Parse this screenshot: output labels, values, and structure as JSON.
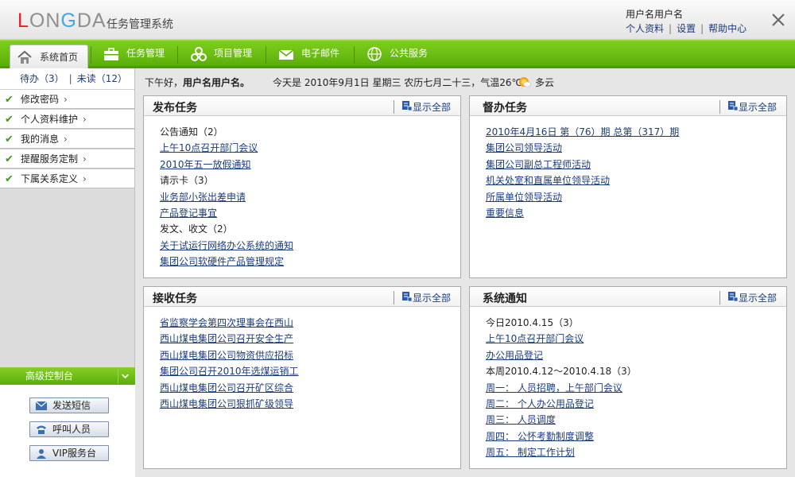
{
  "header": {
    "logo": {
      "l": "L",
      "on": "ON",
      "g": "G",
      "d": "D",
      "a": "A"
    },
    "app_title": "任务管理系统",
    "user_name": "用户名用户名",
    "links": [
      "个人资料",
      "设置",
      "帮助中心"
    ],
    "separator": "|"
  },
  "nav": {
    "items": [
      {
        "label": "系统首页",
        "icon": "home-icon"
      },
      {
        "label": "任务管理",
        "icon": "briefcase-icon"
      },
      {
        "label": "项目管理",
        "icon": "project-icon"
      },
      {
        "label": "电子邮件",
        "icon": "mail-icon"
      },
      {
        "label": "公共服务",
        "icon": "globe-icon"
      }
    ]
  },
  "sidebar": {
    "todo": "待办（3）",
    "unread": "未读（12）",
    "separator": "|",
    "items": [
      {
        "label": "修改密码"
      },
      {
        "label": "个人资料维护"
      },
      {
        "label": "我的消息"
      },
      {
        "label": "提醒服务定制"
      },
      {
        "label": "下属关系定义"
      }
    ],
    "advanced_title": "高级控制台",
    "buttons": [
      "发送短信",
      "呼叫人员",
      "VIP服务台"
    ]
  },
  "greeting": {
    "prefix": "下午好，",
    "user": "用户名用户名。",
    "today": "今天是 2010年9月1日 星期三 农历七月二十三，气温26℃",
    "weather": "多云"
  },
  "panels": {
    "show_all": "显示全部",
    "publish": {
      "title": "发布任务",
      "items": [
        {
          "text": "公告通知（2）",
          "type": "label"
        },
        {
          "text": "上午10点召开部门会议",
          "type": "link"
        },
        {
          "text": "2010年五一放假通知",
          "type": "link"
        },
        {
          "text": "请示卡（3）",
          "type": "label"
        },
        {
          "text": "业务部小张出差申请",
          "type": "link"
        },
        {
          "text": "产品登记事宜",
          "type": "link"
        },
        {
          "text": "发文、收文（2）",
          "type": "label"
        },
        {
          "text": "关于试运行网络办公系统的通知",
          "type": "link"
        },
        {
          "text": "集团公司软硬件产品管理规定",
          "type": "link"
        }
      ]
    },
    "supervise": {
      "title": "督办任务",
      "items": [
        {
          "text": "2010年4月16日 第（76）期 总第（317）期",
          "type": "link"
        },
        {
          "text": "集团公司领导活动",
          "type": "link"
        },
        {
          "text": "集团公司副总工程师活动",
          "type": "link"
        },
        {
          "text": "机关处室和直属单位领导活动",
          "type": "link"
        },
        {
          "text": "所属单位领导活动",
          "type": "link"
        },
        {
          "text": "重要信息",
          "type": "link"
        }
      ]
    },
    "receive": {
      "title": "接收任务",
      "items": [
        {
          "text": "省监察学会第四次理事会在西山",
          "type": "link"
        },
        {
          "text": "西山煤电集团公司召开安全生产",
          "type": "link"
        },
        {
          "text": "西山煤电集团公司物资供应招标",
          "type": "link"
        },
        {
          "text": "集团公司召开2010年选煤运销工",
          "type": "link"
        },
        {
          "text": "西山煤电集团公司召开矿区综合",
          "type": "link"
        },
        {
          "text": "西山煤电集团公司狠抓矿级领导",
          "type": "link"
        }
      ]
    },
    "notice": {
      "title": "系统通知",
      "items": [
        {
          "text": "今日2010.4.15（3）",
          "type": "label"
        },
        {
          "text": "上午10点召开部门会议",
          "type": "link"
        },
        {
          "text": "办公用品登记",
          "type": "link"
        },
        {
          "text": "本周2010.4.12～2010.4.18（3）",
          "type": "label"
        },
        {
          "text": "周一： 人员招聘，上午部门会议",
          "type": "link"
        },
        {
          "text": "周二： 个人办公用品登记",
          "type": "link"
        },
        {
          "text": "周三： 人员调度",
          "type": "link"
        },
        {
          "text": "周四： 公怀考勤制度调整",
          "type": "link"
        },
        {
          "text": "周五： 制定工作计划",
          "type": "link"
        }
      ]
    }
  },
  "colors": {
    "accent_green": "#5aae0a",
    "link_blue": "#1b3c7d",
    "logo_red": "#e51d25",
    "logo_blue": "#3fa6e3"
  }
}
